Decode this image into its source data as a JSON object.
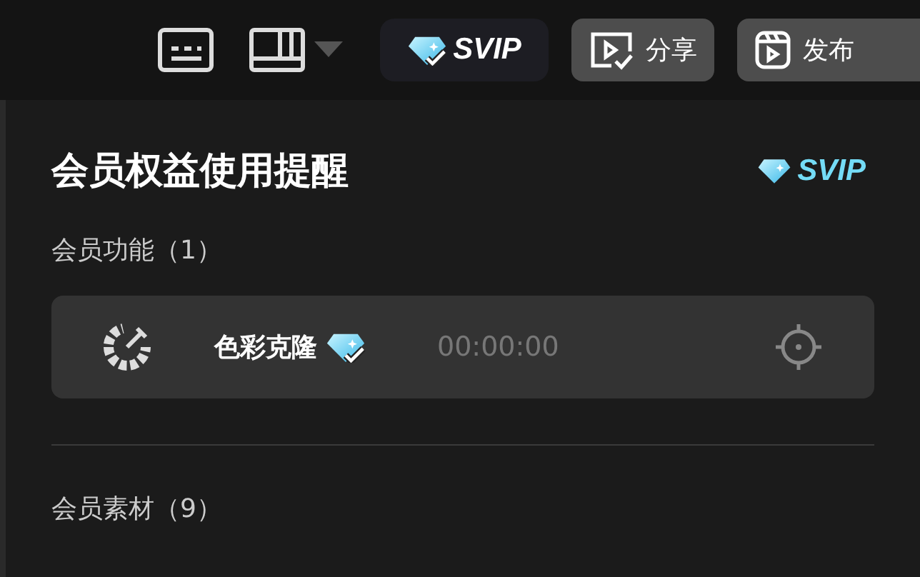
{
  "toolbar": {
    "svip_label": "SVIP",
    "share_label": "分享",
    "publish_label": "发布"
  },
  "popover": {
    "title": "会员权益使用提醒",
    "badge": "SVIP",
    "sections": [
      {
        "heading": "会员功能（1）",
        "items": [
          {
            "name": "色彩克隆",
            "time": "00:00:00"
          }
        ]
      },
      {
        "heading": "会员素材（9）"
      }
    ]
  }
}
